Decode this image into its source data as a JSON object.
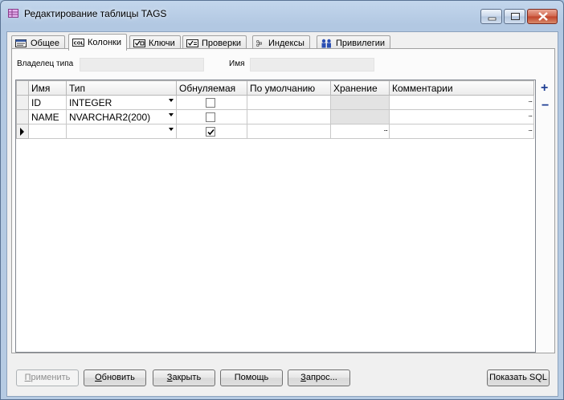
{
  "window": {
    "title": "Редактирование таблицы TAGS"
  },
  "tabs": [
    {
      "label": "Общее",
      "icon": "table-general-icon"
    },
    {
      "label": "Колонки",
      "icon": "columns-icon",
      "active": true
    },
    {
      "label": "Ключи",
      "icon": "keys-icon"
    },
    {
      "label": "Проверки",
      "icon": "checks-icon"
    },
    {
      "label": "Индексы",
      "icon": "indexes-icon"
    },
    {
      "label": "Привилегии",
      "icon": "privileges-icon"
    }
  ],
  "header_fields": {
    "owner_label": "Владелец типа",
    "owner_value": "",
    "name_label": "Имя",
    "name_value": ""
  },
  "grid": {
    "columns": [
      "Имя",
      "Тип",
      "Обнуляемая",
      "По умолчанию",
      "Хранение",
      "Комментарии"
    ],
    "rows": [
      {
        "name": "ID",
        "type": "INTEGER",
        "nullable": false,
        "default": "",
        "storage": "",
        "comment": ""
      },
      {
        "name": "NAME",
        "type": "NVARCHAR2(200)",
        "nullable": false,
        "default": "",
        "storage": "",
        "comment": ""
      },
      {
        "name": "",
        "type": "",
        "nullable": true,
        "default": "",
        "storage": "",
        "comment": ""
      }
    ],
    "ellipsis": "..."
  },
  "side_buttons": {
    "add": "+",
    "remove": "−"
  },
  "buttons": {
    "apply": "Применить",
    "apply_key": "П",
    "apply_rest": "рименить",
    "refresh_key": "О",
    "refresh_rest": "бновить",
    "close_key": "З",
    "close_rest": "акрыть",
    "help_key": "",
    "help": "Помощь",
    "query_key": "З",
    "query_rest": "апрос...",
    "show_sql": "Показать SQL"
  },
  "colors": {
    "accent": "#1f3f94",
    "frame": "#b6cbe3"
  }
}
